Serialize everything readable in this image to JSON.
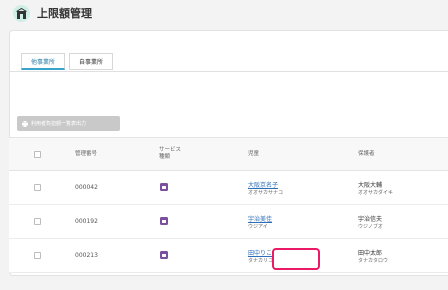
{
  "page": {
    "title": "上限額管理",
    "icon": "building-icon"
  },
  "tabs": [
    {
      "label": "他事業所",
      "active": true
    },
    {
      "label": "自事業所",
      "active": false
    }
  ],
  "export_button": {
    "label": "利用者負担額一覧表出力",
    "icon": "printer-icon"
  },
  "table": {
    "headers": {
      "management_no": "管理番号",
      "service_type_line1": "サービス",
      "service_type_line2": "種類",
      "child": "児童",
      "guardian": "保護者"
    },
    "rows": [
      {
        "no": "000042",
        "child_name": "大阪京名子",
        "child_kana": "オオサカサナコ",
        "guardian_name": "大阪大輔",
        "guardian_kana": "オオサカダイキ"
      },
      {
        "no": "000192",
        "child_name": "宇治美佳",
        "child_kana": "ウジアイ",
        "guardian_name": "宇治信夫",
        "guardian_kana": "ウジノブオ"
      },
      {
        "no": "000213",
        "child_name": "田中りこ",
        "child_kana": "タナカリコ",
        "guardian_name": "田中太郎",
        "guardian_kana": "タナカタロウ"
      }
    ]
  },
  "colors": {
    "tab_active": "#3aa3c9",
    "link": "#2c6fb8",
    "service_icon": "#7b4f9e",
    "highlight": "#ea1a66"
  }
}
